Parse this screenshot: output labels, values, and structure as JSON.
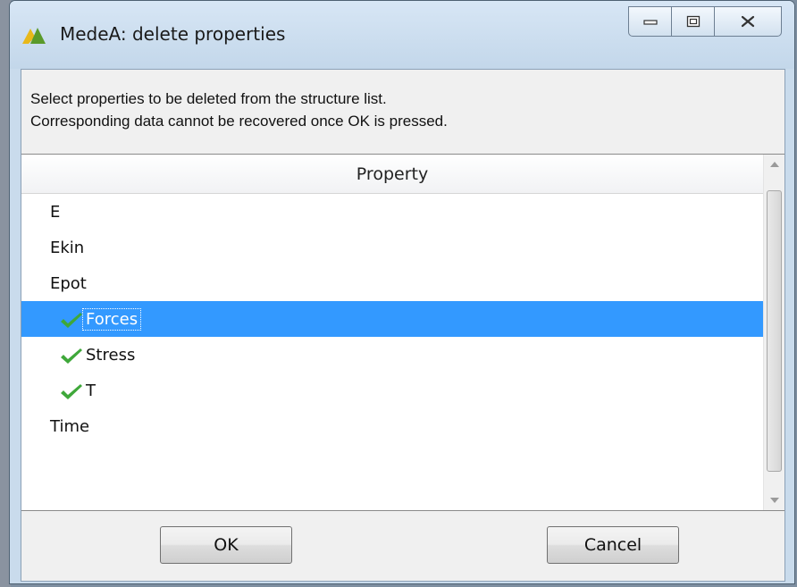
{
  "window": {
    "title": "MedeA: delete properties",
    "icons": {
      "app": "medea-logo-icon",
      "minimize": "minimize-icon",
      "maximize": "maximize-icon",
      "close": "close-icon"
    }
  },
  "instructions": {
    "line1": "Select properties to be deleted from the structure list.",
    "line2": "Corresponding data cannot be recovered once OK is pressed."
  },
  "list": {
    "column_header": "Property",
    "items": [
      {
        "label": "E",
        "checked": false,
        "selected": false
      },
      {
        "label": "Ekin",
        "checked": false,
        "selected": false
      },
      {
        "label": "Epot",
        "checked": false,
        "selected": false
      },
      {
        "label": "Forces",
        "checked": true,
        "selected": true
      },
      {
        "label": "Stress",
        "checked": true,
        "selected": false
      },
      {
        "label": "T",
        "checked": true,
        "selected": false
      },
      {
        "label": "Time",
        "checked": false,
        "selected": false
      }
    ]
  },
  "buttons": {
    "ok": "OK",
    "cancel": "Cancel"
  },
  "colors": {
    "selection": "#3399ff",
    "checkmark": "#3fa83a",
    "titlebar": "#c9dbec"
  }
}
